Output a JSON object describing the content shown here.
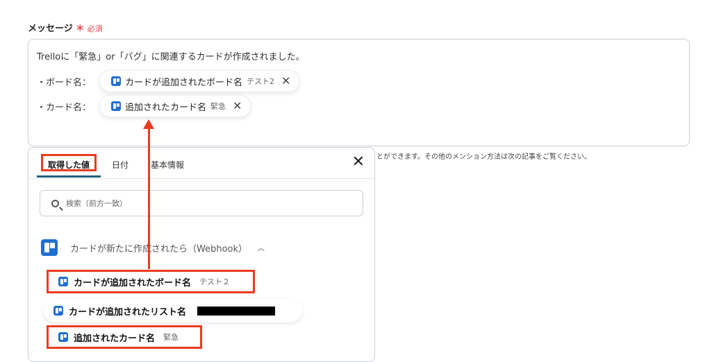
{
  "field": {
    "label": "メッセージ",
    "asterisk": "＊",
    "required": "必須"
  },
  "message": {
    "line1": "Trelloに「緊急」or「バグ」に関連するカードが作成されました。",
    "rows": [
      {
        "label": "・ボード名：",
        "chip_label": "カードが追加されたボード名",
        "chip_value": "テスト2"
      },
      {
        "label": "・カード名：",
        "chip_label": "追加されたカード名",
        "chip_value": "緊急"
      }
    ]
  },
  "helper_text": "とができます。その他のメンション方法は次の記事をご覧ください。",
  "panel": {
    "tabs": [
      "取得した値",
      "日付",
      "基本情報"
    ],
    "close": "✕",
    "search_placeholder": "検索（前方一致）",
    "group_title": "カードが新たに作成されたら（Webhook）",
    "group_chevron": "︿",
    "items": [
      {
        "label": "カードが追加されたボード名",
        "value": "テスト２"
      },
      {
        "label": "カードが追加されたリスト名",
        "value": ""
      },
      {
        "label": "追加されたカード名",
        "value": "緊急"
      }
    ]
  },
  "icons": {
    "chip_remove": "✕",
    "app": "trello-icon"
  },
  "colors": {
    "highlight": "#ea3b1e",
    "trello_blue": "#1f6fd1",
    "required_red": "#e5484d",
    "tab_underline": "#1e5c7a"
  }
}
